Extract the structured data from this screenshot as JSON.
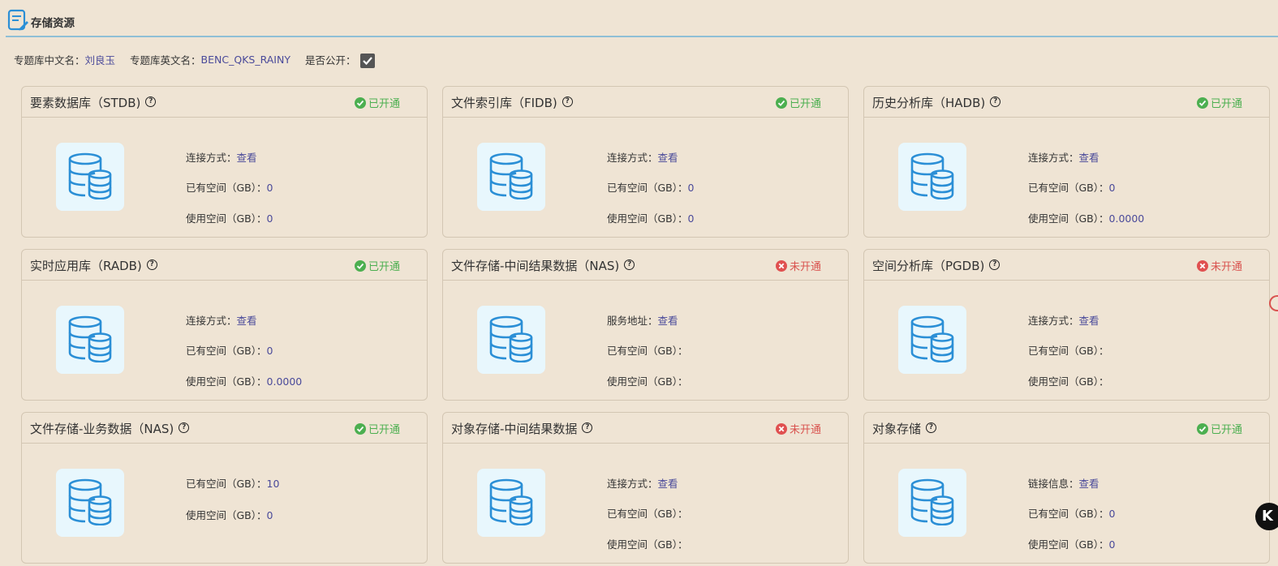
{
  "header": {
    "title": "存储资源"
  },
  "info": {
    "cn_label": "专题库中文名：",
    "cn_value": "刘良玉",
    "en_label": "专题库英文名：",
    "en_value": "BENC_QKS_RAINY",
    "public_label": "是否公开：",
    "public_checked": true
  },
  "cards": [
    {
      "title": "要素数据库（STDB)",
      "status": "已开通",
      "rows": [
        {
          "label": "连接方式：",
          "value": "查看"
        },
        {
          "label": "已有空间（GB）：",
          "value": "0"
        },
        {
          "label": "使用空间（GB）：",
          "value": "0"
        }
      ]
    },
    {
      "title": "文件索引库（FIDB)",
      "status": "已开通",
      "rows": [
        {
          "label": "连接方式：",
          "value": "查看"
        },
        {
          "label": "已有空间（GB）：",
          "value": "0"
        },
        {
          "label": "使用空间（GB）：",
          "value": "0"
        }
      ]
    },
    {
      "title": "历史分析库（HADB)",
      "status": "已开通",
      "rows": [
        {
          "label": "连接方式：",
          "value": "查看"
        },
        {
          "label": "已有空间（GB）：",
          "value": "0"
        },
        {
          "label": "使用空间（GB）：",
          "value": "0.0000"
        }
      ]
    },
    {
      "title": "实时应用库（RADB)",
      "status": "已开通",
      "rows": [
        {
          "label": "连接方式：",
          "value": "查看"
        },
        {
          "label": "已有空间（GB）：",
          "value": "0"
        },
        {
          "label": "使用空间（GB）：",
          "value": "0.0000"
        }
      ]
    },
    {
      "title": "文件存储-中间结果数据（NAS)",
      "status": "未开通",
      "rows": [
        {
          "label": "服务地址：",
          "value": "查看"
        },
        {
          "label": "已有空间（GB）：",
          "value": ""
        },
        {
          "label": "使用空间（GB）：",
          "value": ""
        }
      ]
    },
    {
      "title": "空间分析库（PGDB)",
      "status": "未开通",
      "rows": [
        {
          "label": "连接方式：",
          "value": "查看"
        },
        {
          "label": "已有空间（GB）：",
          "value": ""
        },
        {
          "label": "使用空间（GB）：",
          "value": ""
        }
      ]
    },
    {
      "title": "文件存储-业务数据（NAS)",
      "status": "已开通",
      "rows": [
        {
          "label": "已有空间（GB）：",
          "value": "10"
        },
        {
          "label": "使用空间（GB）：",
          "value": "0"
        }
      ]
    },
    {
      "title": "对象存储-中间结果数据",
      "status": "未开通",
      "rows": [
        {
          "label": "连接方式：",
          "value": "查看"
        },
        {
          "label": "已有空间（GB）：",
          "value": ""
        },
        {
          "label": "使用空间（GB）：",
          "value": ""
        }
      ]
    },
    {
      "title": "对象存储",
      "status": "已开通",
      "rows": [
        {
          "label": "链接信息：",
          "value": "查看"
        },
        {
          "label": "已有空间（GB）：",
          "value": "0"
        },
        {
          "label": "使用空间（GB）：",
          "value": "0"
        }
      ]
    }
  ],
  "float_button": {
    "label": "K"
  },
  "colors": {
    "ok": "#4caf50",
    "bad": "#d9534f",
    "link": "#4a4a9a",
    "icon": "#2b8fd6"
  }
}
